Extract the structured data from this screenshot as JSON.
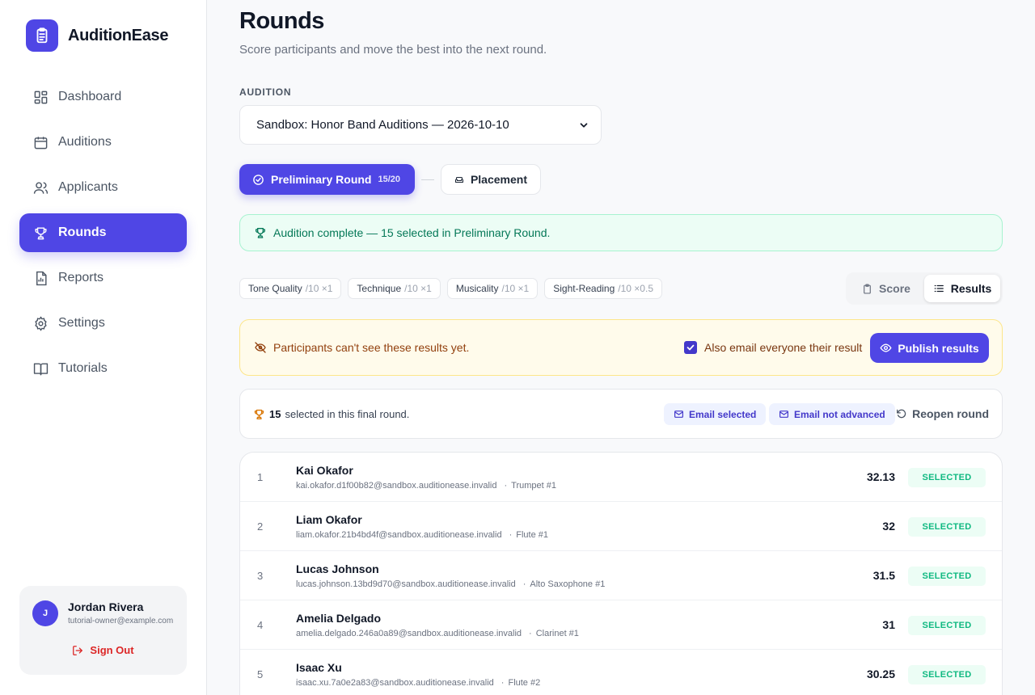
{
  "app": {
    "name": "AuditionEase"
  },
  "sidebar": {
    "items": [
      {
        "label": "Dashboard",
        "icon": "dashboard-icon"
      },
      {
        "label": "Auditions",
        "icon": "calendar-icon"
      },
      {
        "label": "Applicants",
        "icon": "users-icon"
      },
      {
        "label": "Rounds",
        "icon": "trophy-icon",
        "active": true
      },
      {
        "label": "Reports",
        "icon": "report-icon"
      },
      {
        "label": "Settings",
        "icon": "gear-icon"
      },
      {
        "label": "Tutorials",
        "icon": "book-icon"
      }
    ]
  },
  "user": {
    "initial": "J",
    "name": "Jordan Rivera",
    "email": "tutorial-owner@example.com",
    "signout_label": "Sign Out"
  },
  "page": {
    "title": "Rounds",
    "subtitle": "Score participants and move the best into the next round."
  },
  "audition": {
    "label": "AUDITION",
    "selected": "Sandbox: Honor Band Auditions — 2026-10-10"
  },
  "rounds": [
    {
      "label": "Preliminary Round",
      "count": "15/20",
      "active": true
    },
    {
      "label": "Placement",
      "active": false
    }
  ],
  "banner": {
    "text": "Audition complete — 15 selected in Preliminary Round."
  },
  "criteria": [
    {
      "name": "Tone Quality",
      "weight": "/10 ×1"
    },
    {
      "name": "Technique",
      "weight": "/10 ×1"
    },
    {
      "name": "Musicality",
      "weight": "/10 ×1"
    },
    {
      "name": "Sight-Reading",
      "weight": "/10 ×0.5"
    }
  ],
  "view_toggle": {
    "score_label": "Score",
    "results_label": "Results",
    "active": "Results"
  },
  "publish": {
    "message": "Participants can't see these results yet.",
    "email_label": "Also email everyone their result",
    "email_checked": true,
    "button_label": "Publish results"
  },
  "summary": {
    "count": "15",
    "text": "selected in this final round.",
    "email_selected_label": "Email selected",
    "email_not_advanced_label": "Email not advanced",
    "reopen_label": "Reopen round"
  },
  "results": [
    {
      "rank": "1",
      "name": "Kai Okafor",
      "email": "kai.okafor.d1f00b82@sandbox.auditionease.invalid",
      "instrument": "Trumpet #1",
      "score": "32.13",
      "status": "SELECTED"
    },
    {
      "rank": "2",
      "name": "Liam Okafor",
      "email": "liam.okafor.21b4bd4f@sandbox.auditionease.invalid",
      "instrument": "Flute #1",
      "score": "32",
      "status": "SELECTED"
    },
    {
      "rank": "3",
      "name": "Lucas Johnson",
      "email": "lucas.johnson.13bd9d70@sandbox.auditionease.invalid",
      "instrument": "Alto Saxophone #1",
      "score": "31.5",
      "status": "SELECTED"
    },
    {
      "rank": "4",
      "name": "Amelia Delgado",
      "email": "amelia.delgado.246a0a89@sandbox.auditionease.invalid",
      "instrument": "Clarinet #1",
      "score": "31",
      "status": "SELECTED"
    },
    {
      "rank": "5",
      "name": "Isaac Xu",
      "email": "isaac.xu.7a0e2a83@sandbox.auditionease.invalid",
      "instrument": "Flute #2",
      "score": "30.25",
      "status": "SELECTED"
    }
  ],
  "colors": {
    "accent": "#4f46e5",
    "success": "#10b981",
    "warning_bg": "#fffbeb",
    "danger": "#dc2626"
  }
}
